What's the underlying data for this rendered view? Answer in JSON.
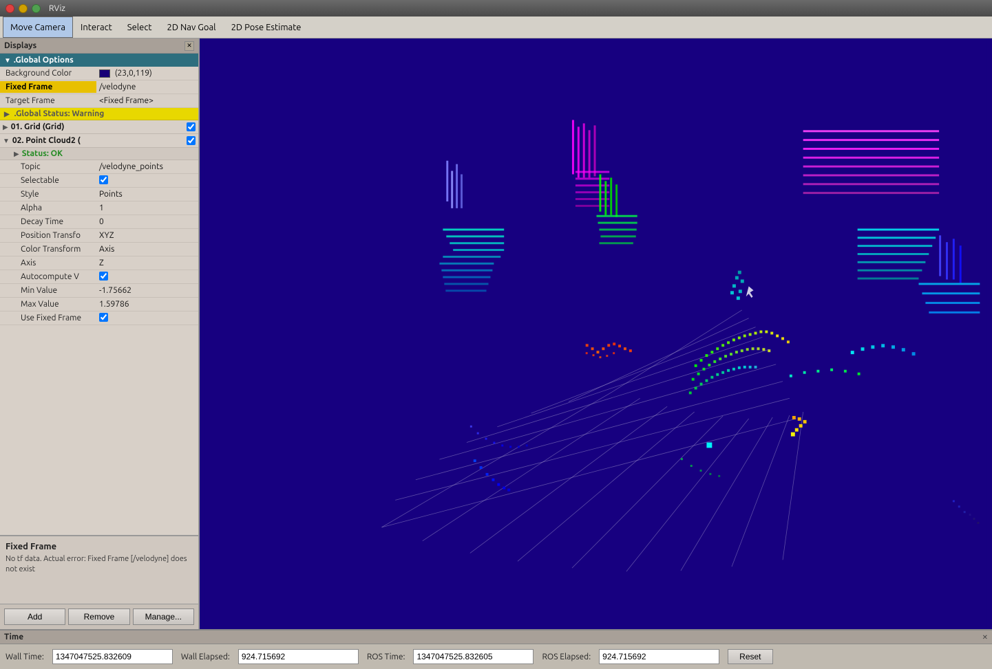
{
  "window": {
    "title": "RViz"
  },
  "menubar": {
    "items": [
      {
        "id": "move-camera",
        "label": "Move Camera",
        "active": true
      },
      {
        "id": "interact",
        "label": "Interact",
        "active": false
      },
      {
        "id": "select",
        "label": "Select",
        "active": false
      },
      {
        "id": "2d-nav-goal",
        "label": "2D Nav Goal",
        "active": false
      },
      {
        "id": "2d-pose-estimate",
        "label": "2D Pose Estimate",
        "active": false
      }
    ]
  },
  "displays_panel": {
    "title": "Displays",
    "global_options": {
      "header": ".Global Options",
      "background_color_label": "Background Color",
      "background_color_value": "(23,0,119)",
      "background_color_hex": "#170077",
      "fixed_frame_label": "Fixed Frame",
      "fixed_frame_value": "/velodyne",
      "target_frame_label": "Target Frame",
      "target_frame_value": "<Fixed Frame>"
    },
    "global_status": {
      "label": ".Global Status: Warning"
    },
    "grid_item": {
      "label": "01. Grid (Grid)",
      "checked": true
    },
    "point_cloud": {
      "label": "02. Point Cloud2 (",
      "checked": true,
      "status": {
        "label": "Status: OK"
      },
      "topic_label": "Topic",
      "topic_value": "/velodyne_points",
      "selectable_label": "Selectable",
      "selectable_checked": true,
      "style_label": "Style",
      "style_value": "Points",
      "alpha_label": "Alpha",
      "alpha_value": "1",
      "decay_time_label": "Decay Time",
      "decay_time_value": "0",
      "position_transform_label": "Position Transfo",
      "position_transform_value": "XYZ",
      "color_transform_label": "Color Transform",
      "color_transform_value": "Axis",
      "axis_label": "Axis",
      "axis_value": "Z",
      "autocompute_label": "Autocompute V",
      "autocompute_checked": true,
      "min_value_label": "Min Value",
      "min_value_value": "-1.75662",
      "max_value_label": "Max Value",
      "max_value_value": "1.59786",
      "use_fixed_frame_label": "Use Fixed Frame",
      "use_fixed_frame_checked": true
    }
  },
  "bottom_info": {
    "title": "Fixed Frame",
    "text": "No tf data. Actual error: Fixed Frame [/velodyne] does not exist"
  },
  "panel_buttons": {
    "add": "Add",
    "remove": "Remove",
    "manage": "Manage..."
  },
  "timebar": {
    "title": "Time",
    "wall_time_label": "Wall Time:",
    "wall_time_value": "1347047525.832609",
    "wall_elapsed_label": "Wall Elapsed:",
    "wall_elapsed_value": "924.715692",
    "ros_time_label": "ROS Time:",
    "ros_time_value": "1347047525.832605",
    "ros_elapsed_label": "ROS Elapsed:",
    "ros_elapsed_value": "924.715692",
    "reset_label": "Reset"
  }
}
